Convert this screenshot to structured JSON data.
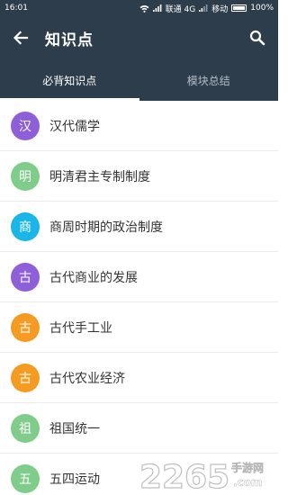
{
  "status": {
    "time": "16:01",
    "carrier1": "联通 4G",
    "carrier2": "移动",
    "battery": "100%"
  },
  "header": {
    "title": "知识点",
    "back_icon": "arrow-left-icon",
    "search_icon": "search-icon",
    "background": "#2e3d4c"
  },
  "tabs": [
    {
      "label": "必背知识点",
      "active": true
    },
    {
      "label": "模块总结",
      "active": false
    }
  ],
  "items": [
    {
      "badge": "汉",
      "label": "汉代儒学",
      "color": "#8e5fd9"
    },
    {
      "badge": "明",
      "label": "明清君主专制制度",
      "color": "#7fcc8b"
    },
    {
      "badge": "商",
      "label": "商周时期的政治制度",
      "color": "#1ab6e8"
    },
    {
      "badge": "古",
      "label": "古代商业的发展",
      "color": "#8e5fd9"
    },
    {
      "badge": "古",
      "label": "古代手工业",
      "color": "#f59b21"
    },
    {
      "badge": "古",
      "label": "古代农业经济",
      "color": "#f59b21"
    },
    {
      "badge": "祖",
      "label": "祖国统一",
      "color": "#7fcc8b"
    },
    {
      "badge": "五",
      "label": "五四运动",
      "color": "#7fcc8b"
    }
  ],
  "watermark": {
    "number": "2265",
    "text": ".com",
    "cn": "手游网"
  }
}
